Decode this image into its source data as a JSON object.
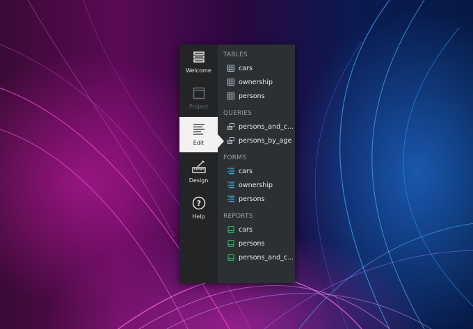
{
  "sidebar": {
    "modes": [
      {
        "label": "Welcome",
        "icon": "welcome-icon",
        "state": "normal"
      },
      {
        "label": "Project",
        "icon": "project-icon",
        "state": "disabled"
      },
      {
        "label": "Edit",
        "icon": "edit-icon",
        "state": "active"
      },
      {
        "label": "Design",
        "icon": "design-icon",
        "state": "normal"
      },
      {
        "label": "Help",
        "icon": "help-icon",
        "state": "normal"
      }
    ]
  },
  "navigator": {
    "tables": {
      "header": "TABLES",
      "items": [
        "cars",
        "ownership",
        "persons"
      ],
      "icon": "table-icon",
      "color": "#a9b8c8"
    },
    "queries": {
      "header": "QUERIES",
      "items": [
        "persons_and_c...",
        "persons_by_age"
      ],
      "icon": "query-icon",
      "color": "#a9b8c8"
    },
    "forms": {
      "header": "FORMS",
      "items": [
        "cars",
        "ownership",
        "persons"
      ],
      "icon": "form-icon",
      "color": "#3daee9"
    },
    "reports": {
      "header": "REPORTS",
      "items": [
        "cars",
        "persons",
        "persons_and_c..."
      ],
      "icon": "report-icon",
      "color": "#27ae60"
    }
  }
}
